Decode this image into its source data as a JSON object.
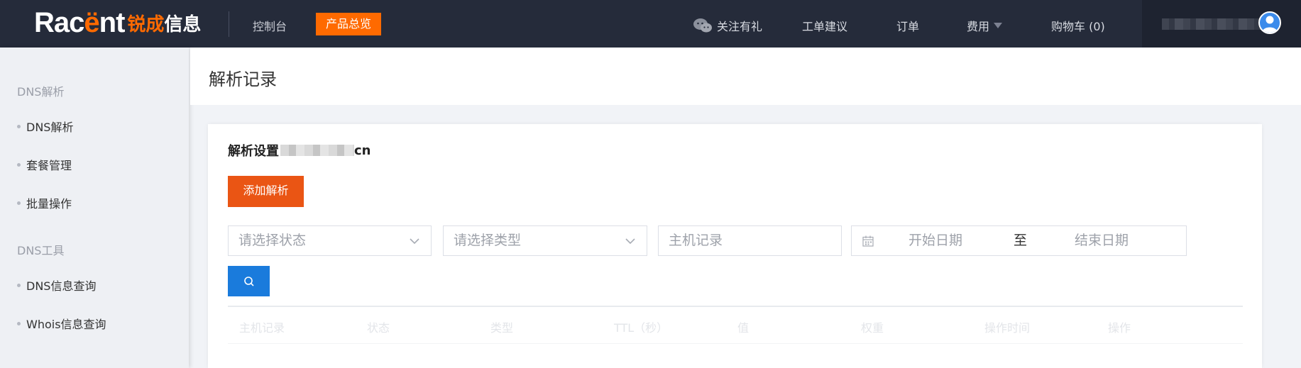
{
  "topbar": {
    "logo": {
      "word_start": "Rac",
      "word_accent": "ë",
      "word_end": "nt",
      "cn_accent": "锐成",
      "cn_main": "信息"
    },
    "console": "控制台",
    "products": "产品总览",
    "follow": "关注有礼",
    "ticket": "工单建议",
    "orders": "订单",
    "fees": "费用",
    "cart": "购物车 (0)"
  },
  "sidebar": {
    "group1": "DNS解析",
    "group1_items": [
      "DNS解析",
      "套餐管理",
      "批量操作"
    ],
    "group2": "DNS工具",
    "group2_items": [
      "DNS信息查询",
      "Whois信息查询"
    ]
  },
  "page": {
    "title": "解析记录"
  },
  "card": {
    "title_prefix": "解析设置",
    "domain_suffix": "cn",
    "add_button": "添加解析",
    "status_placeholder": "请选择状态",
    "type_placeholder": "请选择类型",
    "host_placeholder": "主机记录",
    "date_start": "开始日期",
    "date_sep": "至",
    "date_end": "结束日期"
  },
  "table": {
    "columns": [
      "主机记录",
      "状态",
      "类型",
      "TTL（秒）",
      "值",
      "权重",
      "操作时间",
      "操作"
    ]
  },
  "colors": {
    "topbar": "#252b3a",
    "brand_orange": "#ff6a00",
    "add_button": "#ea5514",
    "search_button": "#1a7bdc"
  },
  "icons": {
    "wechat": "wechat-icon",
    "avatar": "user-avatar-icon",
    "search": "search-icon",
    "calendar": "calendar-icon",
    "chevron": "chevron-down-icon"
  }
}
